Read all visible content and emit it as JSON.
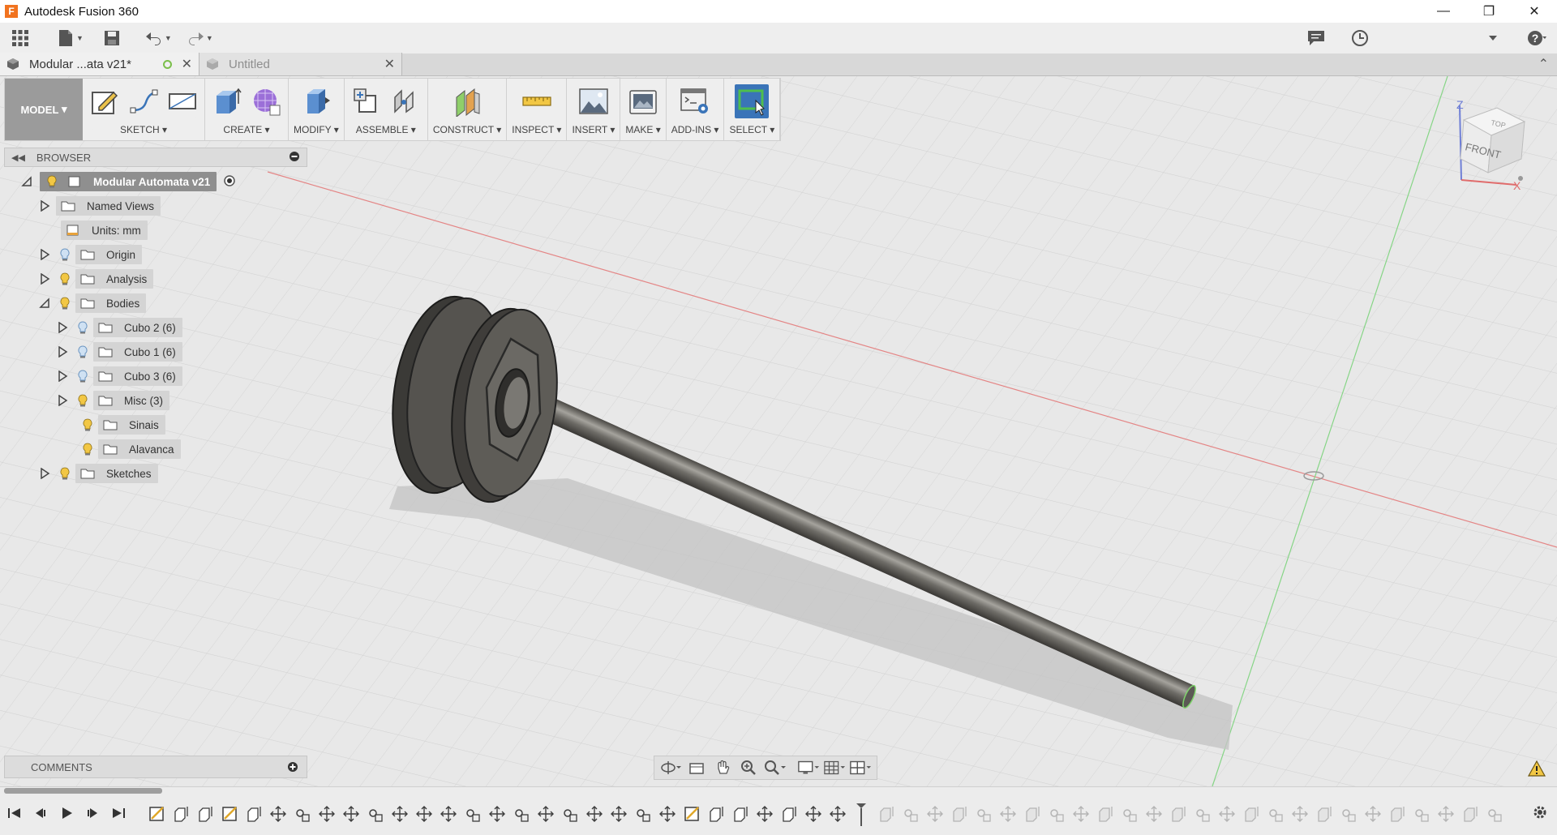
{
  "window": {
    "title": "Autodesk Fusion 360",
    "logo_letter": "F",
    "minimize": "—",
    "restore": "❐",
    "close": "✕"
  },
  "tabs": [
    {
      "label": "Modular ...ata v21*",
      "active": true
    },
    {
      "label": "Untitled",
      "active": false
    }
  ],
  "toolbar": {
    "workspace": "MODEL",
    "groups": [
      {
        "label": "SKETCH ▾"
      },
      {
        "label": "CREATE ▾"
      },
      {
        "label": "MODIFY ▾"
      },
      {
        "label": "ASSEMBLE ▾"
      },
      {
        "label": "CONSTRUCT ▾"
      },
      {
        "label": "INSPECT ▾"
      },
      {
        "label": "INSERT ▾"
      },
      {
        "label": "MAKE ▾"
      },
      {
        "label": "ADD-INS ▾"
      },
      {
        "label": "SELECT ▾"
      }
    ]
  },
  "browser": {
    "title": "BROWSER",
    "items": [
      {
        "label": "Modular Automata v21"
      },
      {
        "label": "Named Views"
      },
      {
        "label": "Units: mm"
      },
      {
        "label": "Origin"
      },
      {
        "label": "Analysis"
      },
      {
        "label": "Bodies"
      },
      {
        "label": "Cubo 2 (6)"
      },
      {
        "label": "Cubo 1 (6)"
      },
      {
        "label": "Cubo 3 (6)"
      },
      {
        "label": "Misc (3)"
      },
      {
        "label": "Sinais"
      },
      {
        "label": "Alavanca"
      },
      {
        "label": "Sketches"
      }
    ]
  },
  "comments": {
    "title": "COMMENTS"
  },
  "viewcube": {
    "front": "FRONT",
    "top": "TOP",
    "axis_z": "Z",
    "axis_x": "X"
  },
  "colors": {
    "accent": "#3a74b8",
    "bulb": "#f2c744",
    "bulb_off": "#8fb7df",
    "axis_x": "#e45b5b",
    "axis_y": "#5ed35e"
  }
}
